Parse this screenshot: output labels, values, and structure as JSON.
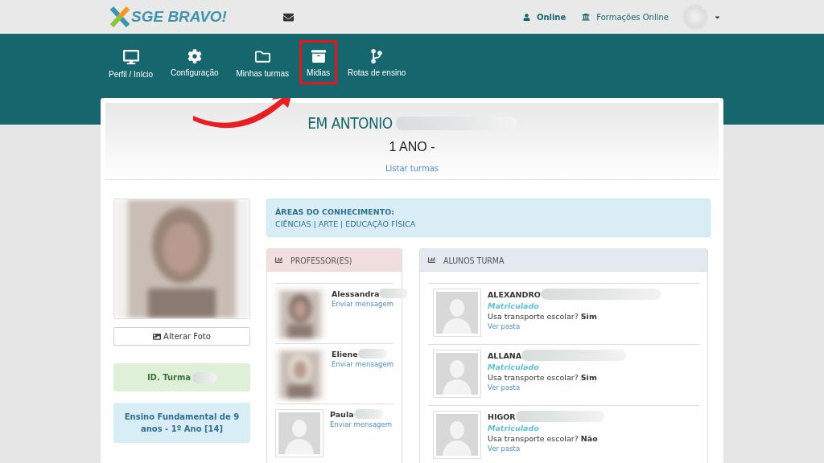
{
  "header": {
    "logo": "SGE BRAVO!",
    "status": "Online",
    "link": "Formações Online"
  },
  "nav": [
    {
      "label": "Perfil / Início",
      "kind": "monitor",
      "highlighted": false
    },
    {
      "label": "Configuração",
      "kind": "gear",
      "highlighted": false
    },
    {
      "label": "Minhas turmas",
      "kind": "folder",
      "highlighted": false
    },
    {
      "label": "Midias",
      "kind": "archive",
      "highlighted": true
    },
    {
      "label": "Rotas de ensino",
      "kind": "branch",
      "highlighted": false
    }
  ],
  "school": {
    "title": "EM ANTONIO",
    "grade": "1 ANO -",
    "link": "Listar turmas"
  },
  "profile": {
    "button": "Alterar Foto",
    "class_id": "ID. Turma",
    "level": "Ensino Fundamental de 9 anos - 1º Ano [14]"
  },
  "areas": {
    "title": "ÁREAS DO CONHECIMENTO:",
    "list": "CIÊNCIAS | ARTE | EDUCAÇÃO FÍSICA"
  },
  "teachers": {
    "title": "PROFESSOR(ES)",
    "items": [
      {
        "name": "Alessandra",
        "link": "Enviar mensagem",
        "kind": "picture"
      },
      {
        "name": "Eliene",
        "link": "Enviar mensagem",
        "kind": "picture"
      },
      {
        "name": "Paula",
        "link": "Enviar mensagem",
        "kind": "avatar"
      }
    ]
  },
  "students": {
    "title": "ALUNOS TURMA",
    "items": [
      {
        "name": "ALEXANDRO",
        "status": "Matriculado",
        "question": "Usa transporte escolar?",
        "answer": "Sim",
        "link": "Ver pasta"
      },
      {
        "name": "ALLANA",
        "status": "Matriculado",
        "question": "Usa transporte escolar?",
        "answer": "Sim",
        "link": "Ver pasta"
      },
      {
        "name": "HIGOR",
        "status": "Matriculado",
        "question": "Usa transporte escolar?",
        "answer": "Não",
        "link": "Ver pasta"
      }
    ]
  }
}
